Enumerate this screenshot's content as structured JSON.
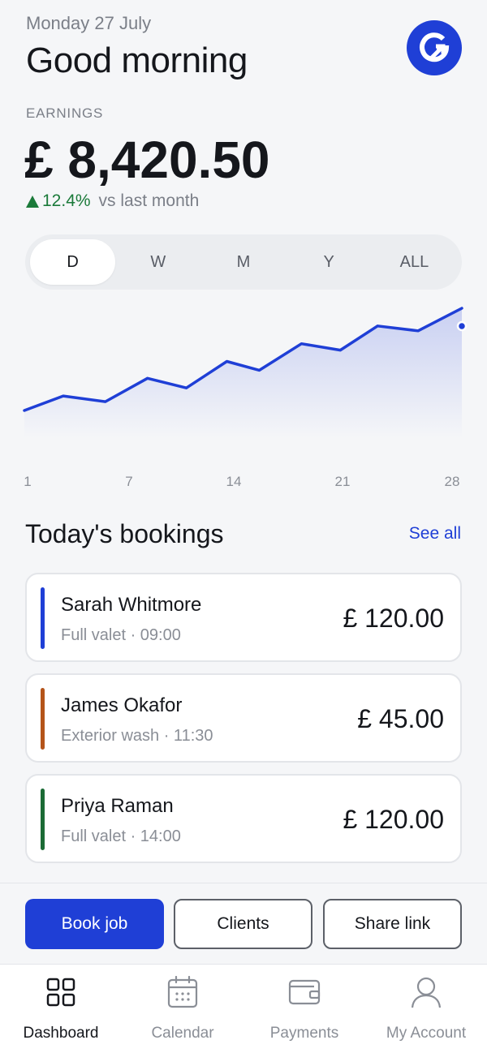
{
  "header": {
    "date": "Monday 27 July",
    "greeting": "Good morning",
    "logo_icon": "g-arrow-logo"
  },
  "earnings": {
    "label": "EARNINGS",
    "value": "£ 8,420.50",
    "change": "12.4%",
    "change_suffix": "vs last month",
    "change_direction": "up"
  },
  "range_selector": {
    "options": [
      "D",
      "W",
      "M",
      "Y",
      "ALL"
    ],
    "selected": "D"
  },
  "chart_data": {
    "type": "area",
    "x_ticks": [
      "1",
      "7",
      "14",
      "21",
      "28"
    ],
    "points": [
      {
        "x": 1,
        "y": 1
      },
      {
        "x": 3.4,
        "y": 19
      },
      {
        "x": 6,
        "y": 12
      },
      {
        "x": 8.6,
        "y": 41
      },
      {
        "x": 11,
        "y": 29
      },
      {
        "x": 13.5,
        "y": 62
      },
      {
        "x": 15.5,
        "y": 51
      },
      {
        "x": 18.1,
        "y": 84
      },
      {
        "x": 20.5,
        "y": 76
      },
      {
        "x": 22.8,
        "y": 106
      },
      {
        "x": 25.3,
        "y": 100
      },
      {
        "x": 28,
        "y": 128
      }
    ],
    "xlim": [
      1,
      28
    ],
    "ylim": [
      0,
      128
    ],
    "last_point_marker": true,
    "colors": {
      "line": "#1f3fd6",
      "fill_top": "#c9d0f2",
      "fill_bottom": "#f5f6f8"
    }
  },
  "bookings": {
    "title": "Today's bookings",
    "see_all": "See all",
    "items": [
      {
        "name": "Sarah Whitmore",
        "meta": "Full valet · 09:00",
        "amount": "£ 120.00",
        "color": "#1f3fd6"
      },
      {
        "name": "James Okafor",
        "meta": "Exterior wash · 11:30",
        "amount": "£ 45.00",
        "color": "#b4541a"
      },
      {
        "name": "Priya Raman",
        "meta": "Full valet · 14:00",
        "amount": "£ 120.00",
        "color": "#1b6b35"
      }
    ]
  },
  "actions": {
    "book_job": "Book job",
    "clients": "Clients",
    "share_link": "Share link"
  },
  "tabbar": {
    "items": [
      {
        "label": "Dashboard",
        "icon": "grid-icon",
        "active": true
      },
      {
        "label": "Calendar",
        "icon": "calendar-icon",
        "active": false
      },
      {
        "label": "Payments",
        "icon": "wallet-icon",
        "active": false
      },
      {
        "label": "My Account",
        "icon": "person-icon",
        "active": false
      }
    ]
  }
}
